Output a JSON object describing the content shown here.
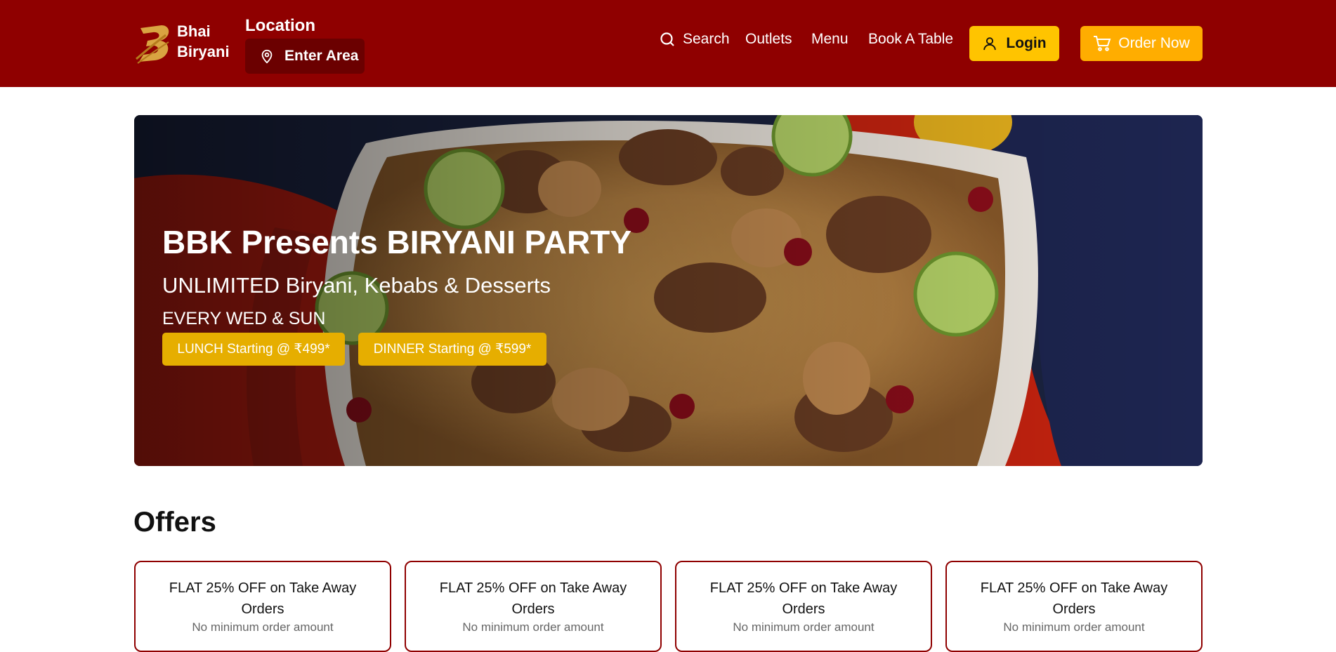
{
  "colors": {
    "header_bg": "#8f0000",
    "login_bg": "#ffc400",
    "order_bg": "#ffad00",
    "pill_bg": "#e6ae00",
    "card_border": "#8f0000"
  },
  "brand": {
    "name_line1": "Bhai",
    "name_line2": "Biryani"
  },
  "location": {
    "title": "Location",
    "button_label": "Enter Area",
    "icon": "location-pin-icon"
  },
  "nav": {
    "search": "Search",
    "outlets": "Outlets",
    "menu": "Menu",
    "book_table": "Book A Table",
    "login": "Login",
    "order_now": "Order Now"
  },
  "hero": {
    "title": "BBK Presents BIRYANI PARTY",
    "subtitle": "UNLIMITED Biryani, Kebabs & Desserts",
    "days": "EVERY WED & SUN",
    "lunch": "LUNCH Starting @ ₹499*",
    "dinner": "DINNER Starting @ ₹599*"
  },
  "offers": {
    "title": "Offers",
    "cards": [
      {
        "title": "FLAT 25% OFF on Take Away Orders",
        "subtitle": "No minimum order amount"
      },
      {
        "title": "FLAT 25% OFF on Take Away Orders",
        "subtitle": "No minimum order amount"
      },
      {
        "title": "FLAT 25% OFF on Take Away Orders",
        "subtitle": "No minimum order amount"
      },
      {
        "title": "FLAT 25% OFF on Take Away Orders",
        "subtitle": "No minimum order amount"
      }
    ]
  }
}
